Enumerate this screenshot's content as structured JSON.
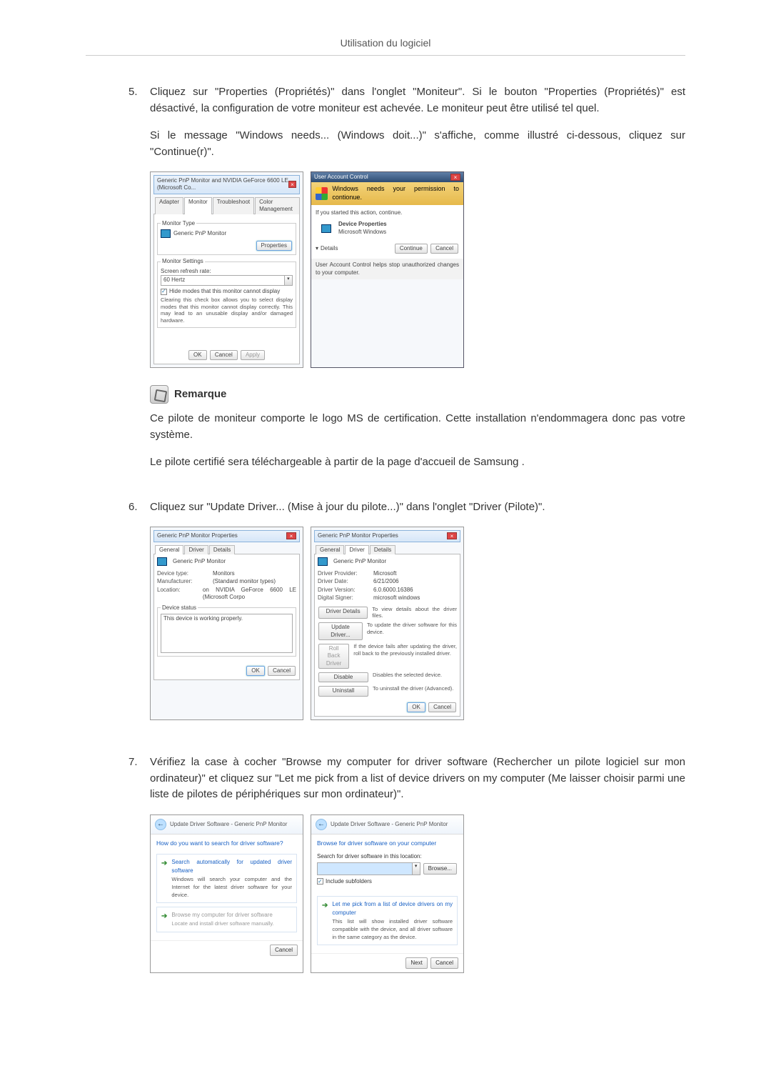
{
  "header": {
    "title": "Utilisation du logiciel"
  },
  "step5": {
    "num": "5.",
    "p1": "Cliquez sur \"Properties (Propriétés)\" dans l'onglet \"Moniteur\". Si le bouton \"Properties (Propriétés)\" est désactivé, la configuration de votre moniteur est achevée. Le moniteur peut être utilisé tel quel.",
    "p2": "Si le message \"Windows needs... (Windows doit...)\" s'affiche, comme illustré ci-dessous, cliquez sur \"Continue(r)\"."
  },
  "monitorProps": {
    "winTitle": "Generic PnP Monitor and NVIDIA GeForce 6600 LE (Microsoft Co...",
    "tabs": [
      "Adapter",
      "Monitor",
      "Troubleshoot",
      "Color Management"
    ],
    "monitorTypeLabel": "Monitor Type",
    "monitorTypeValue": "Generic PnP Monitor",
    "propsBtn": "Properties",
    "settingsLegend": "Monitor Settings",
    "refreshLabel": "Screen refresh rate:",
    "refreshValue": "60 Hertz",
    "hideModes": "Hide modes that this monitor cannot display",
    "hideModesDesc": "Clearing this check box allows you to select display modes that this monitor cannot display correctly. This may lead to an unusable display and/or damaged hardware.",
    "ok": "OK",
    "cancel": "Cancel",
    "apply": "Apply"
  },
  "uac": {
    "winTitle": "User Account Control",
    "band": "Windows needs your permission to contionue.",
    "started": "If you started this action, continue.",
    "iconName": "Device Properties",
    "publisher": "Microsoft Windows",
    "details": "Details",
    "continue": "Continue",
    "cancel": "Cancel",
    "footer": "User Account Control helps stop unauthorized changes to your computer."
  },
  "remark": {
    "label": "Remarque",
    "p1": "Ce pilote de moniteur comporte le logo MS de certification. Cette installation n'endommagera donc pas votre système.",
    "p2": "Le pilote certifié sera téléchargeable à partir de la page d'accueil de Samsung ."
  },
  "step6": {
    "num": "6.",
    "p1": "Cliquez sur \"Update Driver... (Mise à jour du pilote...)\" dans l'onglet \"Driver (Pilote)\"."
  },
  "propsGeneral": {
    "winTitle": "Generic PnP Monitor Properties",
    "tabs": [
      "General",
      "Driver",
      "Details"
    ],
    "name": "Generic PnP Monitor",
    "deviceTypeK": "Device type:",
    "deviceTypeV": "Monitors",
    "manufacturerK": "Manufacturer:",
    "manufacturerV": "(Standard monitor types)",
    "locationK": "Location:",
    "locationV": "on NVIDIA GeForce 6600 LE (Microsoft Corpo",
    "statusLegend": "Device status",
    "statusText": "This device is working properly.",
    "ok": "OK",
    "cancel": "Cancel"
  },
  "propsDriver": {
    "winTitle": "Generic PnP Monitor Properties",
    "tabs": [
      "General",
      "Driver",
      "Details"
    ],
    "name": "Generic PnP Monitor",
    "providerK": "Driver Provider:",
    "providerV": "Microsoft",
    "dateK": "Driver Date:",
    "dateV": "6/21/2006",
    "versionK": "Driver Version:",
    "versionV": "6.0.6000.16386",
    "signerK": "Digital Signer:",
    "signerV": "microsoft windows",
    "btnDetails": "Driver Details",
    "descDetails": "To view details about the driver files.",
    "btnUpdate": "Update Driver...",
    "descUpdate": "To update the driver software for this device.",
    "btnRollback": "Roll Back Driver",
    "descRollback": "If the device fails after updating the driver, roll back to the previously installed driver.",
    "btnDisable": "Disable",
    "descDisable": "Disables the selected device.",
    "btnUninstall": "Uninstall",
    "descUninstall": "To uninstall the driver (Advanced).",
    "ok": "OK",
    "cancel": "Cancel"
  },
  "step7": {
    "num": "7.",
    "p1": "Vérifiez la case à cocher \"Browse my computer for driver software (Rechercher un pilote logiciel sur mon ordinateur)\" et cliquez sur \"Let me pick from a list of device drivers on my computer (Me laisser choisir parmi une liste de pilotes de périphériques sur mon ordinateur)\"."
  },
  "wizardA": {
    "crumb": "Update Driver Software - Generic PnP Monitor",
    "heading": "How do you want to search for driver software?",
    "opt1Title": "Search automatically for updated driver software",
    "opt1Desc": "Windows will search your computer and the Internet for the latest driver software for your device.",
    "opt2Title": "Browse my computer for driver software",
    "opt2Desc": "Locate and install driver software manually.",
    "cancel": "Cancel"
  },
  "wizardB": {
    "crumb": "Update Driver Software - Generic PnP Monitor",
    "heading": "Browse for driver software on your computer",
    "searchLabel": "Search for driver software in this location:",
    "browse": "Browse...",
    "include": "Include subfolders",
    "optTitle": "Let me pick from a list of device drivers on my computer",
    "optDesc": "This list will show installed driver software compatible with the device, and all driver software in the same category as the device.",
    "next": "Next",
    "cancel": "Cancel"
  }
}
